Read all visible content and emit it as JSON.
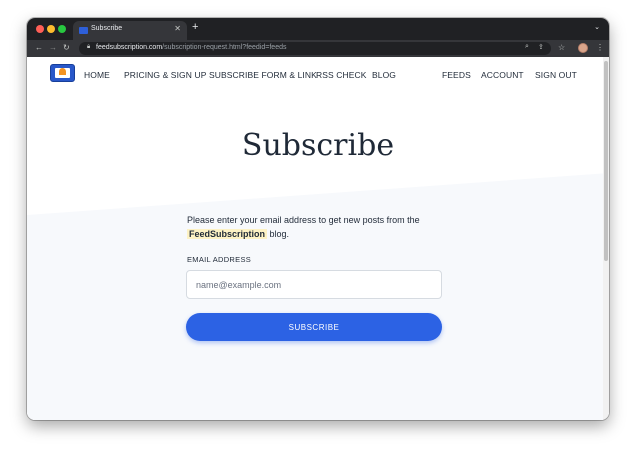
{
  "browser": {
    "tab_title": "Subscribe",
    "new_tab_glyph": "+",
    "url_host": "feedsubscription.com",
    "url_path": "/subscription-request.html?feedid=feeds",
    "icons": [
      "back-icon",
      "forward-icon",
      "reload-icon",
      "lock-icon",
      "search-icon",
      "share-icon",
      "star-icon",
      "extensions-icon",
      "sidebar-icon",
      "profile-avatar",
      "menu-icon"
    ]
  },
  "nav": {
    "items": [
      {
        "label": "HOME"
      },
      {
        "label": "PRICING & SIGN UP"
      },
      {
        "label": "SUBSCRIBE FORM & LINK"
      },
      {
        "label": "RSS CHECK"
      },
      {
        "label": "BLOG"
      },
      {
        "label": "FEEDS"
      },
      {
        "label": "ACCOUNT"
      },
      {
        "label": "SIGN OUT"
      }
    ]
  },
  "main": {
    "title": "Subscribe",
    "intro_before": "Please enter your email address to get new posts from the",
    "blog_name": "FeedSubscription",
    "intro_after": "blog.",
    "email_label": "EMAIL ADDRESS",
    "email_placeholder": "name@example.com",
    "email_value": "",
    "button_label": "SUBSCRIBE"
  },
  "colors": {
    "accent": "#2c62e4",
    "highlight": "#fdf2c4",
    "chrome_dark": "#202124"
  }
}
